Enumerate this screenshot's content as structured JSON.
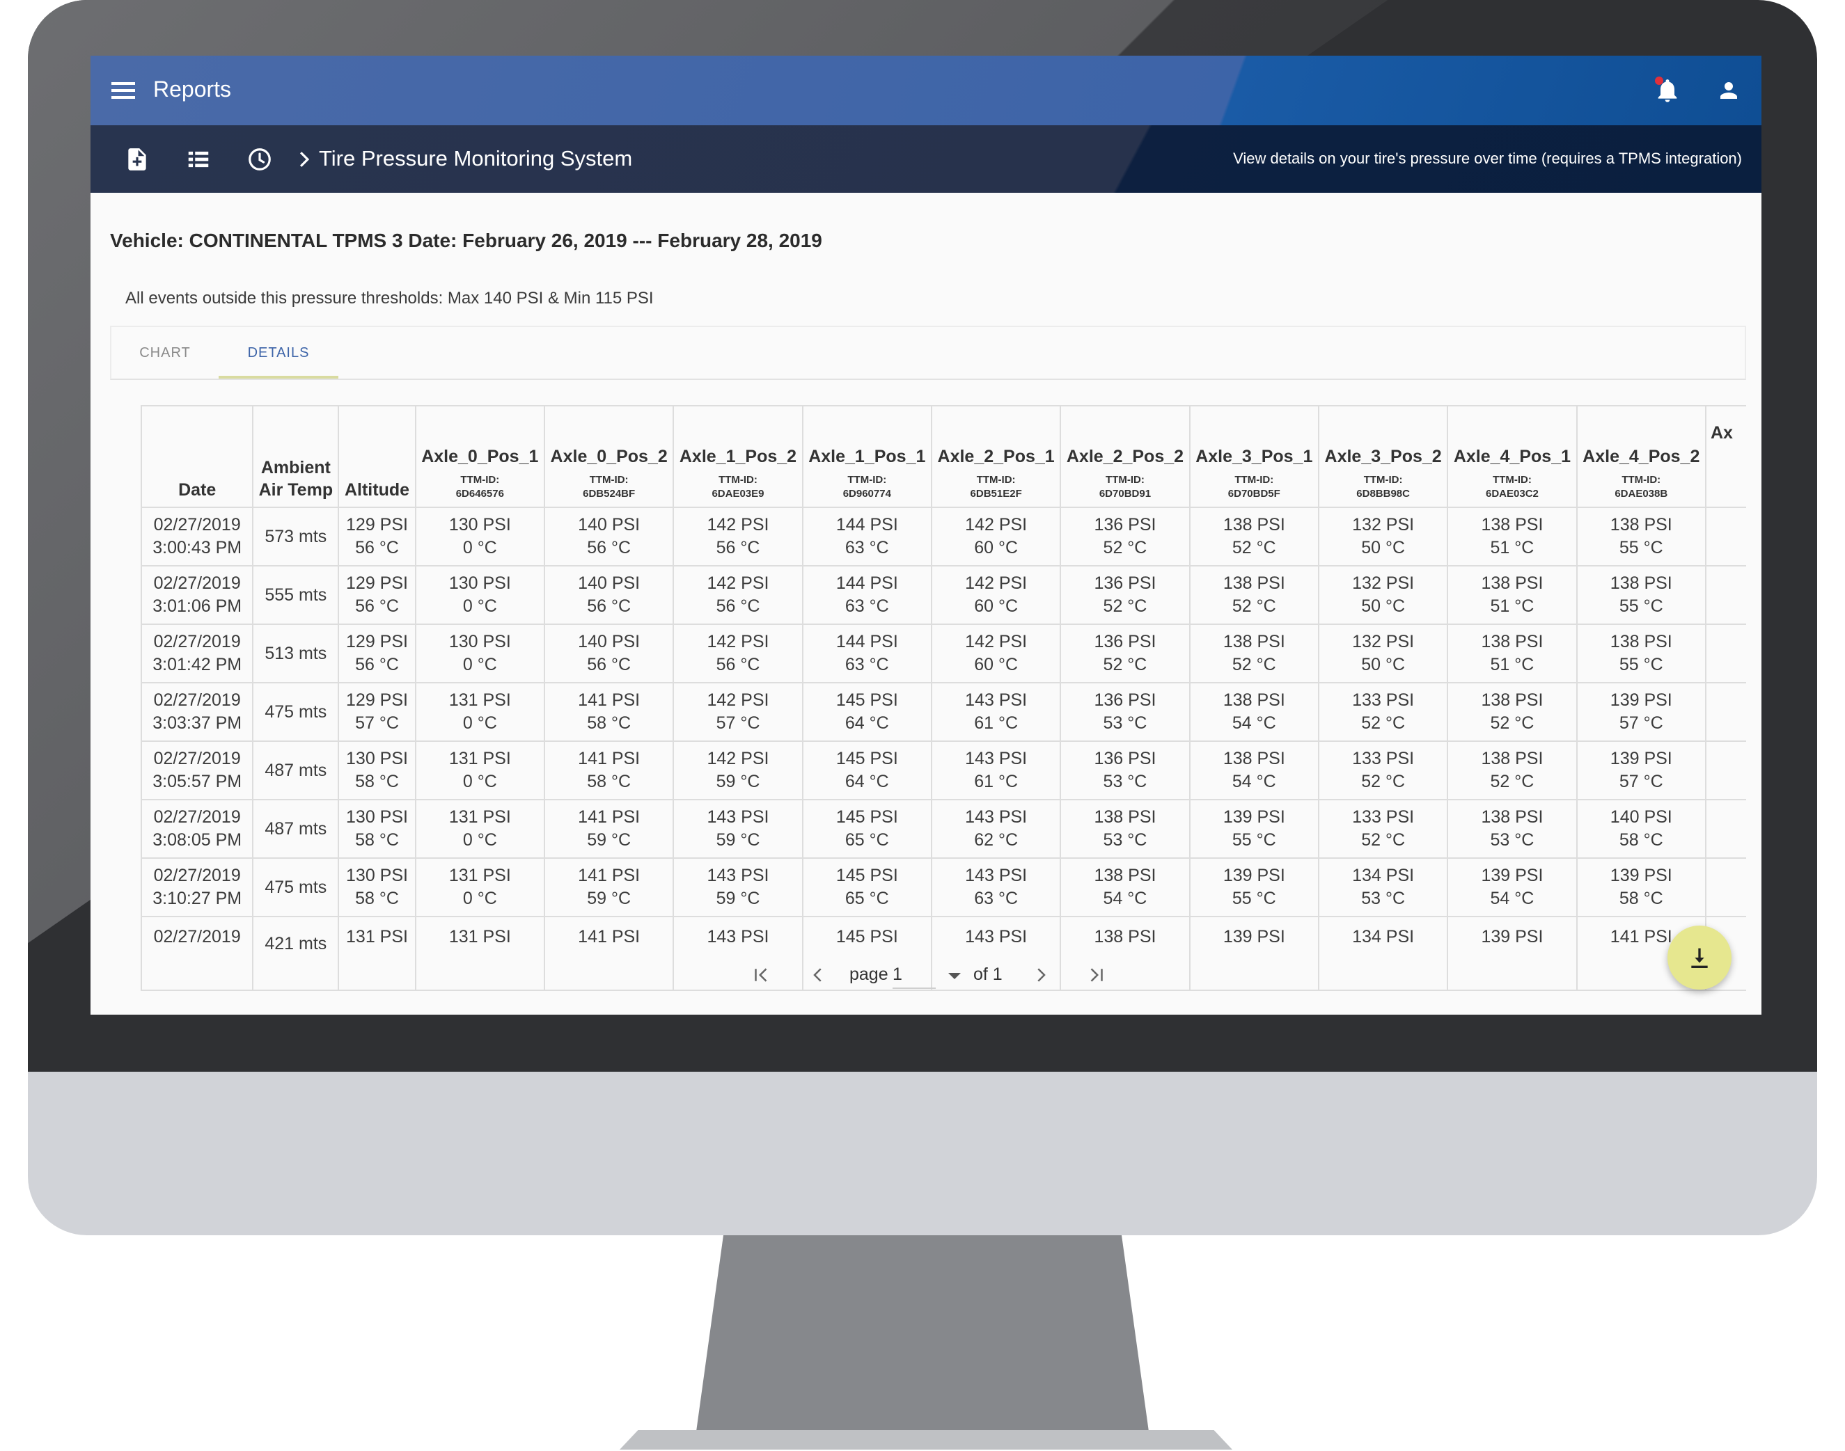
{
  "app": {
    "title": "Reports"
  },
  "header": {
    "breadcrumb": "Tire Pressure Monitoring System",
    "description": "View details on your tire's pressure over time (requires a TPMS integration)"
  },
  "report": {
    "vehicle_line": "Vehicle: CONTINENTAL TPMS 3 Date: February 26, 2019 --- February 28, 2019",
    "thresholds": "All events outside this pressure thresholds: Max 140 PSI & Min 115 PSI"
  },
  "tabs": [
    {
      "label": "CHART",
      "active": false
    },
    {
      "label": "DETAILS",
      "active": true
    }
  ],
  "table": {
    "headers": [
      {
        "name": "Date"
      },
      {
        "name": "Ambient Air Temp"
      },
      {
        "name": "Altitude"
      },
      {
        "name": "Axle_0_Pos_1",
        "ttm_label": "TTM-ID:",
        "ttm": "6D646576"
      },
      {
        "name": "Axle_0_Pos_2",
        "ttm_label": "TTM-ID:",
        "ttm": "6DB524BF"
      },
      {
        "name": "Axle_1_Pos_2",
        "ttm_label": "TTM-ID:",
        "ttm": "6DAE03E9"
      },
      {
        "name": "Axle_1_Pos_1",
        "ttm_label": "TTM-ID:",
        "ttm": "6D960774"
      },
      {
        "name": "Axle_2_Pos_1",
        "ttm_label": "TTM-ID:",
        "ttm": "6DB51E2F"
      },
      {
        "name": "Axle_2_Pos_2",
        "ttm_label": "TTM-ID:",
        "ttm": "6D70BD91"
      },
      {
        "name": "Axle_3_Pos_1",
        "ttm_label": "TTM-ID:",
        "ttm": "6D70BD5F"
      },
      {
        "name": "Axle_3_Pos_2",
        "ttm_label": "TTM-ID:",
        "ttm": "6D8BB98C"
      },
      {
        "name": "Axle_4_Pos_1",
        "ttm_label": "TTM-ID:",
        "ttm": "6DAE03C2"
      },
      {
        "name": "Axle_4_Pos_2",
        "ttm_label": "TTM-ID:",
        "ttm": "6DAE038B"
      },
      {
        "name": "Ax"
      }
    ],
    "rows": [
      {
        "date": "02/27/2019",
        "time": "3:00:43 PM",
        "ambient": "573 mts",
        "cells": [
          [
            "129 PSI",
            "56 °C"
          ],
          [
            "130 PSI",
            "0 °C"
          ],
          [
            "140 PSI",
            "56 °C"
          ],
          [
            "142 PSI",
            "56 °C"
          ],
          [
            "144 PSI",
            "63 °C"
          ],
          [
            "142 PSI",
            "60 °C"
          ],
          [
            "136 PSI",
            "52 °C"
          ],
          [
            "138 PSI",
            "52 °C"
          ],
          [
            "132 PSI",
            "50 °C"
          ],
          [
            "138 PSI",
            "51 °C"
          ],
          [
            "138 PSI",
            "55 °C"
          ]
        ]
      },
      {
        "date": "02/27/2019",
        "time": "3:01:06 PM",
        "ambient": "555 mts",
        "cells": [
          [
            "129 PSI",
            "56 °C"
          ],
          [
            "130 PSI",
            "0 °C"
          ],
          [
            "140 PSI",
            "56 °C"
          ],
          [
            "142 PSI",
            "56 °C"
          ],
          [
            "144 PSI",
            "63 °C"
          ],
          [
            "142 PSI",
            "60 °C"
          ],
          [
            "136 PSI",
            "52 °C"
          ],
          [
            "138 PSI",
            "52 °C"
          ],
          [
            "132 PSI",
            "50 °C"
          ],
          [
            "138 PSI",
            "51 °C"
          ],
          [
            "138 PSI",
            "55 °C"
          ]
        ]
      },
      {
        "date": "02/27/2019",
        "time": "3:01:42 PM",
        "ambient": "513 mts",
        "cells": [
          [
            "129 PSI",
            "56 °C"
          ],
          [
            "130 PSI",
            "0 °C"
          ],
          [
            "140 PSI",
            "56 °C"
          ],
          [
            "142 PSI",
            "56 °C"
          ],
          [
            "144 PSI",
            "63 °C"
          ],
          [
            "142 PSI",
            "60 °C"
          ],
          [
            "136 PSI",
            "52 °C"
          ],
          [
            "138 PSI",
            "52 °C"
          ],
          [
            "132 PSI",
            "50 °C"
          ],
          [
            "138 PSI",
            "51 °C"
          ],
          [
            "138 PSI",
            "55 °C"
          ]
        ]
      },
      {
        "date": "02/27/2019",
        "time": "3:03:37 PM",
        "ambient": "475 mts",
        "cells": [
          [
            "129 PSI",
            "57 °C"
          ],
          [
            "131 PSI",
            "0 °C"
          ],
          [
            "141 PSI",
            "58 °C"
          ],
          [
            "142 PSI",
            "57 °C"
          ],
          [
            "145 PSI",
            "64 °C"
          ],
          [
            "143 PSI",
            "61 °C"
          ],
          [
            "136 PSI",
            "53 °C"
          ],
          [
            "138 PSI",
            "54 °C"
          ],
          [
            "133 PSI",
            "52 °C"
          ],
          [
            "138 PSI",
            "52 °C"
          ],
          [
            "139 PSI",
            "57 °C"
          ]
        ]
      },
      {
        "date": "02/27/2019",
        "time": "3:05:57 PM",
        "ambient": "487 mts",
        "cells": [
          [
            "130 PSI",
            "58 °C"
          ],
          [
            "131 PSI",
            "0 °C"
          ],
          [
            "141 PSI",
            "58 °C"
          ],
          [
            "142 PSI",
            "59 °C"
          ],
          [
            "145 PSI",
            "64 °C"
          ],
          [
            "143 PSI",
            "61 °C"
          ],
          [
            "136 PSI",
            "53 °C"
          ],
          [
            "138 PSI",
            "54 °C"
          ],
          [
            "133 PSI",
            "52 °C"
          ],
          [
            "138 PSI",
            "52 °C"
          ],
          [
            "139 PSI",
            "57 °C"
          ]
        ]
      },
      {
        "date": "02/27/2019",
        "time": "3:08:05 PM",
        "ambient": "487 mts",
        "cells": [
          [
            "130 PSI",
            "58 °C"
          ],
          [
            "131 PSI",
            "0 °C"
          ],
          [
            "141 PSI",
            "59 °C"
          ],
          [
            "143 PSI",
            "59 °C"
          ],
          [
            "145 PSI",
            "65 °C"
          ],
          [
            "143 PSI",
            "62 °C"
          ],
          [
            "138 PSI",
            "53 °C"
          ],
          [
            "139 PSI",
            "55 °C"
          ],
          [
            "133 PSI",
            "52 °C"
          ],
          [
            "138 PSI",
            "53 °C"
          ],
          [
            "140 PSI",
            "58 °C"
          ]
        ]
      },
      {
        "date": "02/27/2019",
        "time": "3:10:27 PM",
        "ambient": "475 mts",
        "cells": [
          [
            "130 PSI",
            "58 °C"
          ],
          [
            "131 PSI",
            "0 °C"
          ],
          [
            "141 PSI",
            "59 °C"
          ],
          [
            "143 PSI",
            "59 °C"
          ],
          [
            "145 PSI",
            "65 °C"
          ],
          [
            "143 PSI",
            "63 °C"
          ],
          [
            "138 PSI",
            "54 °C"
          ],
          [
            "139 PSI",
            "55 °C"
          ],
          [
            "134 PSI",
            "53 °C"
          ],
          [
            "139 PSI",
            "54 °C"
          ],
          [
            "139 PSI",
            "58 °C"
          ]
        ]
      },
      {
        "date": "02/27/2019",
        "time": "",
        "ambient": "421 mts",
        "cells": [
          [
            "131 PSI",
            ""
          ],
          [
            "131 PSI",
            ""
          ],
          [
            "141 PSI",
            ""
          ],
          [
            "143 PSI",
            ""
          ],
          [
            "145 PSI",
            ""
          ],
          [
            "143 PSI",
            ""
          ],
          [
            "138 PSI",
            ""
          ],
          [
            "139 PSI",
            ""
          ],
          [
            "134 PSI",
            ""
          ],
          [
            "139 PSI",
            ""
          ],
          [
            "141 PSI",
            ""
          ]
        ]
      }
    ]
  },
  "pagination": {
    "page_label": "page",
    "current": "1",
    "of_label": "of 1"
  },
  "icons": {
    "menu": "menu-icon",
    "bell": "bell-icon",
    "user": "user-icon",
    "new_report": "file-plus-icon",
    "list": "list-icon",
    "history": "clock-icon",
    "download": "download-icon"
  },
  "colors": {
    "appbar": "#3d64a8",
    "subbar": "#27324c",
    "accent": "#3d64a8",
    "fab": "#e6e78f",
    "notification_dot": "#e0303b"
  }
}
